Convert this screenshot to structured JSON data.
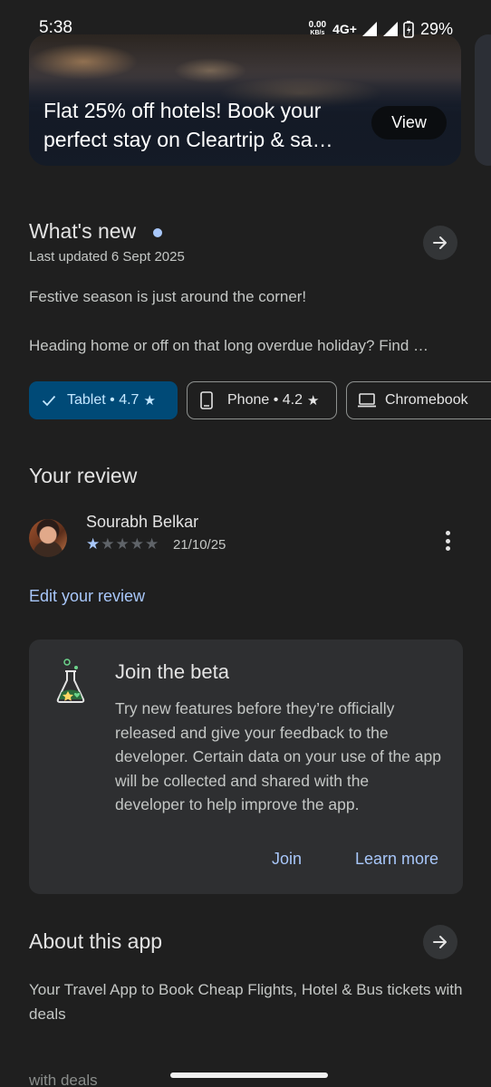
{
  "status_bar": {
    "time": "5:38",
    "data_rate_value": "0.00",
    "data_rate_unit": "KB/s",
    "network": "4G+",
    "battery": "29%"
  },
  "banner": {
    "text": "Flat 25% off hotels! Book your perfect stay on Cleartrip & sa…",
    "button": "View"
  },
  "whats_new": {
    "title": "What's new",
    "updated": "Last updated 6 Sept 2025",
    "line1": "Festive season is just around the corner!",
    "line2": "Heading home or off on that long overdue holiday? Find …"
  },
  "devices": [
    {
      "label": "Tablet • 4.7",
      "icon": "check-icon",
      "selected": true
    },
    {
      "label": "Phone • 4.2",
      "icon": "phone-icon",
      "selected": false
    },
    {
      "label": "Chromebook",
      "icon": "laptop-icon",
      "selected": false
    }
  ],
  "your_review": {
    "title": "Your review",
    "reviewer": "Sourabh Belkar",
    "rating": 1,
    "rating_max": 5,
    "date": "21/10/25",
    "edit_link": "Edit your review"
  },
  "beta": {
    "title": "Join the beta",
    "description": "Try new features before they’re officially released and give your feedback to the developer. Certain data on your use of the app will be collected and shared with the developer to help improve the app.",
    "join": "Join",
    "learn_more": "Learn more"
  },
  "about": {
    "title": "About this app",
    "description": "Your Travel App to Book Cheap Flights, Hotel & Bus tickets with deals",
    "cut_off_text": "with deals"
  },
  "colors": {
    "background": "#1f1f1f",
    "accent": "#a8c7fa",
    "chip_selected_bg": "#004a77",
    "card_bg": "#2e2f31"
  }
}
